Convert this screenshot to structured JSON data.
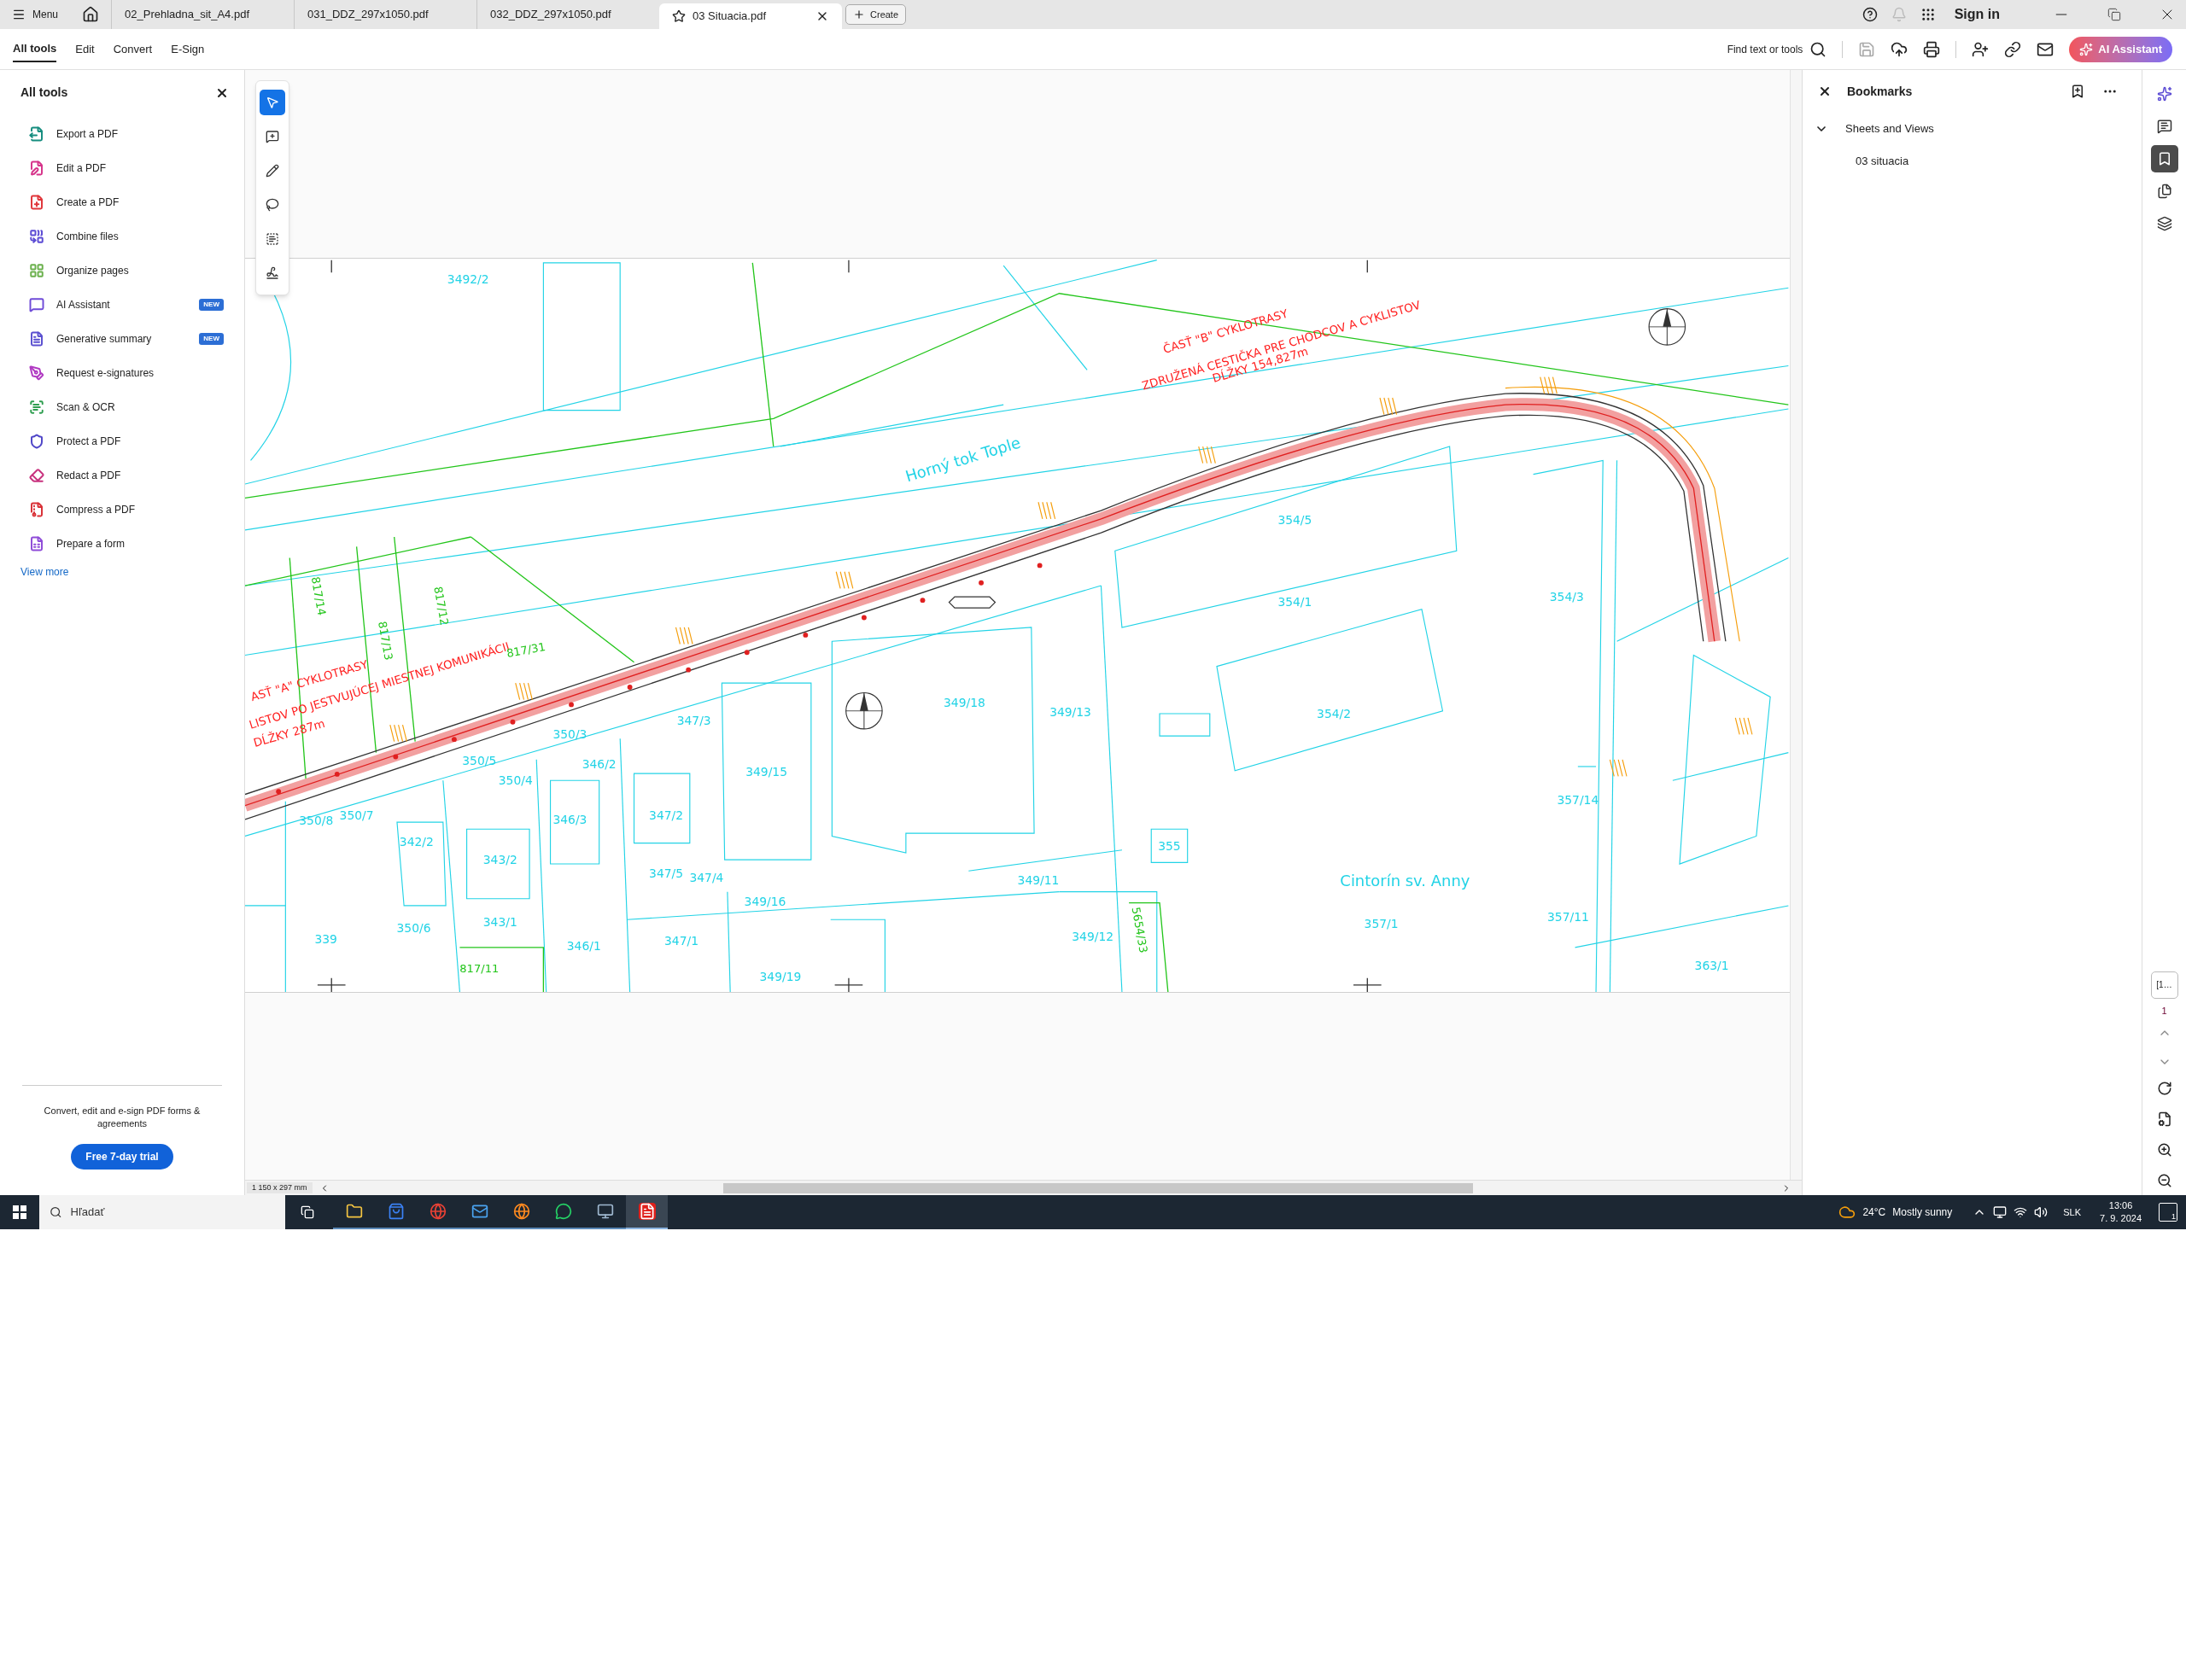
{
  "tab_bar": {
    "menu": "Menu",
    "tabs": [
      {
        "label": "02_Prehladna_sit_A4.pdf",
        "selected": false
      },
      {
        "label": "031_DDZ_297x1050.pdf",
        "selected": false
      },
      {
        "label": "032_DDZ_297x1050.pdf",
        "selected": false
      },
      {
        "label": "03 Situacia.pdf",
        "selected": true
      }
    ],
    "create": "Create",
    "sign_in": "Sign in"
  },
  "toolbar": {
    "menu": [
      {
        "label": "All tools",
        "selected": true
      },
      {
        "label": "Edit",
        "selected": false
      },
      {
        "label": "Convert",
        "selected": false
      },
      {
        "label": "E-Sign",
        "selected": false
      }
    ],
    "search": "Find text or tools",
    "ai_button": "AI Assistant"
  },
  "tools_panel": {
    "title": "All tools",
    "items": [
      {
        "label": "Export a PDF",
        "color": "#168d7f"
      },
      {
        "label": "Edit a PDF",
        "color": "#d6338a"
      },
      {
        "label": "Create a PDF",
        "color": "#e0353a"
      },
      {
        "label": "Combine files",
        "color": "#5b4bd4"
      },
      {
        "label": "Organize pages",
        "color": "#6ab04c"
      },
      {
        "label": "AI Assistant",
        "color": "#6f4bd8",
        "badge": "NEW"
      },
      {
        "label": "Generative summary",
        "color": "#5a4fd0",
        "badge": "NEW"
      },
      {
        "label": "Request e-signatures",
        "color": "#b03ac2"
      },
      {
        "label": "Scan & OCR",
        "color": "#2e9e4f"
      },
      {
        "label": "Protect a PDF",
        "color": "#4f46c8"
      },
      {
        "label": "Redact a PDF",
        "color": "#c8327e"
      },
      {
        "label": "Compress a PDF",
        "color": "#d93036"
      },
      {
        "label": "Prepare a form",
        "color": "#8e4bd8"
      }
    ],
    "view_more": "View more",
    "promo": "Convert, edit and e-sign PDF forms & agreements",
    "trial_button": "Free 7-day trial"
  },
  "floating_tools": [
    {
      "selected": true
    },
    {
      "selected": false
    },
    {
      "selected": false
    },
    {
      "selected": false
    },
    {
      "selected": false
    },
    {
      "selected": false
    }
  ],
  "drawing": {
    "labels": [
      {
        "text": "3492/2",
        "kind": "parcel"
      },
      {
        "text": "Horný tok Tople",
        "kind": "place"
      },
      {
        "text": "ČASŤ \"B\" CYKLOTRASY",
        "kind": "title"
      },
      {
        "text": "ZDRUŽENÁ CESTIČKA PRE CHODCOV A CYKLISTOV",
        "kind": "title"
      },
      {
        "text": "DĹŽKY 154,827m",
        "kind": "title"
      },
      {
        "text": "ASŤ \"A\" CYKLOTRASY",
        "kind": "title"
      },
      {
        "text": "LISTOV PO JESTVUJÚCEJ MIESTNEJ KOMUNIKÁCII",
        "kind": "title"
      },
      {
        "text": "DĹŽKY 287m",
        "kind": "title"
      },
      {
        "text": "817/14",
        "kind": "green"
      },
      {
        "text": "817/13",
        "kind": "green"
      },
      {
        "text": "817/12",
        "kind": "green"
      },
      {
        "text": "817/31",
        "kind": "green"
      },
      {
        "text": "817/11",
        "kind": "green"
      },
      {
        "text": "5654/33",
        "kind": "green"
      },
      {
        "text": "354/5",
        "kind": "parcel"
      },
      {
        "text": "354/1",
        "kind": "parcel"
      },
      {
        "text": "354/3",
        "kind": "parcel"
      },
      {
        "text": "354/2",
        "kind": "parcel"
      },
      {
        "text": "349/18",
        "kind": "parcel"
      },
      {
        "text": "349/13",
        "kind": "parcel"
      },
      {
        "text": "349/15",
        "kind": "parcel"
      },
      {
        "text": "350/3",
        "kind": "parcel"
      },
      {
        "text": "350/5",
        "kind": "parcel"
      },
      {
        "text": "350/4",
        "kind": "parcel"
      },
      {
        "text": "346/2",
        "kind": "parcel"
      },
      {
        "text": "347/3",
        "kind": "parcel"
      },
      {
        "text": "347/2",
        "kind": "parcel"
      },
      {
        "text": "346/3",
        "kind": "parcel"
      },
      {
        "text": "342/2",
        "kind": "parcel"
      },
      {
        "text": "343/2",
        "kind": "parcel"
      },
      {
        "text": "350/8",
        "kind": "parcel"
      },
      {
        "text": "350/7",
        "kind": "parcel"
      },
      {
        "text": "349/11",
        "kind": "parcel"
      },
      {
        "text": "349/16",
        "kind": "parcel"
      },
      {
        "text": "347/5",
        "kind": "parcel"
      },
      {
        "text": "347/4",
        "kind": "parcel"
      },
      {
        "text": "355",
        "kind": "parcel"
      },
      {
        "text": "343/1",
        "kind": "parcel"
      },
      {
        "text": "350/6",
        "kind": "parcel"
      },
      {
        "text": "339",
        "kind": "parcel"
      },
      {
        "text": "346/1",
        "kind": "parcel"
      },
      {
        "text": "347/1",
        "kind": "parcel"
      },
      {
        "text": "349/12",
        "kind": "parcel"
      },
      {
        "text": "349/19",
        "kind": "parcel"
      },
      {
        "text": "Cintorín sv. Anny",
        "kind": "place"
      },
      {
        "text": "357/1",
        "kind": "parcel"
      },
      {
        "text": "357/14",
        "kind": "parcel"
      },
      {
        "text": "357/11",
        "kind": "parcel"
      },
      {
        "text": "363/1",
        "kind": "parcel"
      }
    ]
  },
  "status_bar": {
    "page_size": "1 150 x 297 mm"
  },
  "bookmarks": {
    "title": "Bookmarks",
    "tree": [
      {
        "label": "Sheets and Views",
        "expanded": true,
        "children": [
          {
            "label": "03 situacia"
          }
        ]
      }
    ]
  },
  "side_rail": {
    "tools": [
      {
        "selected": false
      },
      {
        "selected": false
      },
      {
        "selected": true
      },
      {
        "selected": false
      },
      {
        "selected": false
      }
    ],
    "page_field": "[1…",
    "page_number": "1"
  },
  "taskbar": {
    "search_placeholder": "Hľadať",
    "apps": [
      {
        "selected": false
      },
      {
        "selected": false
      },
      {
        "selected": false
      },
      {
        "selected": false
      },
      {
        "selected": false
      },
      {
        "selected": false
      },
      {
        "selected": false
      },
      {
        "selected": true
      }
    ],
    "weather": {
      "temperature": "24°C",
      "condition": "Mostly sunny"
    },
    "language": "SLK",
    "time": "13:06",
    "date": "7. 9. 2024",
    "notifications": "1"
  }
}
